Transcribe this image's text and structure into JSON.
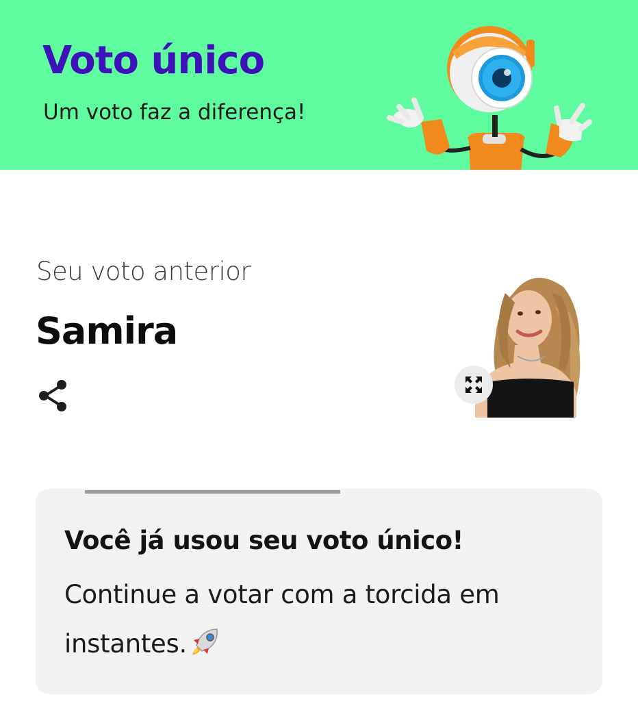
{
  "banner": {
    "title": "Voto único",
    "subtitle": "Um voto faz a diferença!",
    "mascot": "big-brother-eye-robot-mascot",
    "background_color": "#5ffc9f",
    "title_color": "#3d12b8"
  },
  "previous_vote": {
    "label": "Seu voto anterior",
    "name": "Samira",
    "share_icon": "share-icon",
    "expand_icon": "expand-arrows-icon",
    "photo": "participant-photo"
  },
  "notice": {
    "title": "Você já usou seu voto único!",
    "body": "Continue a votar com a torcida em instantes.",
    "emoji_icon": "rocket-icon",
    "progress": 0.45
  }
}
